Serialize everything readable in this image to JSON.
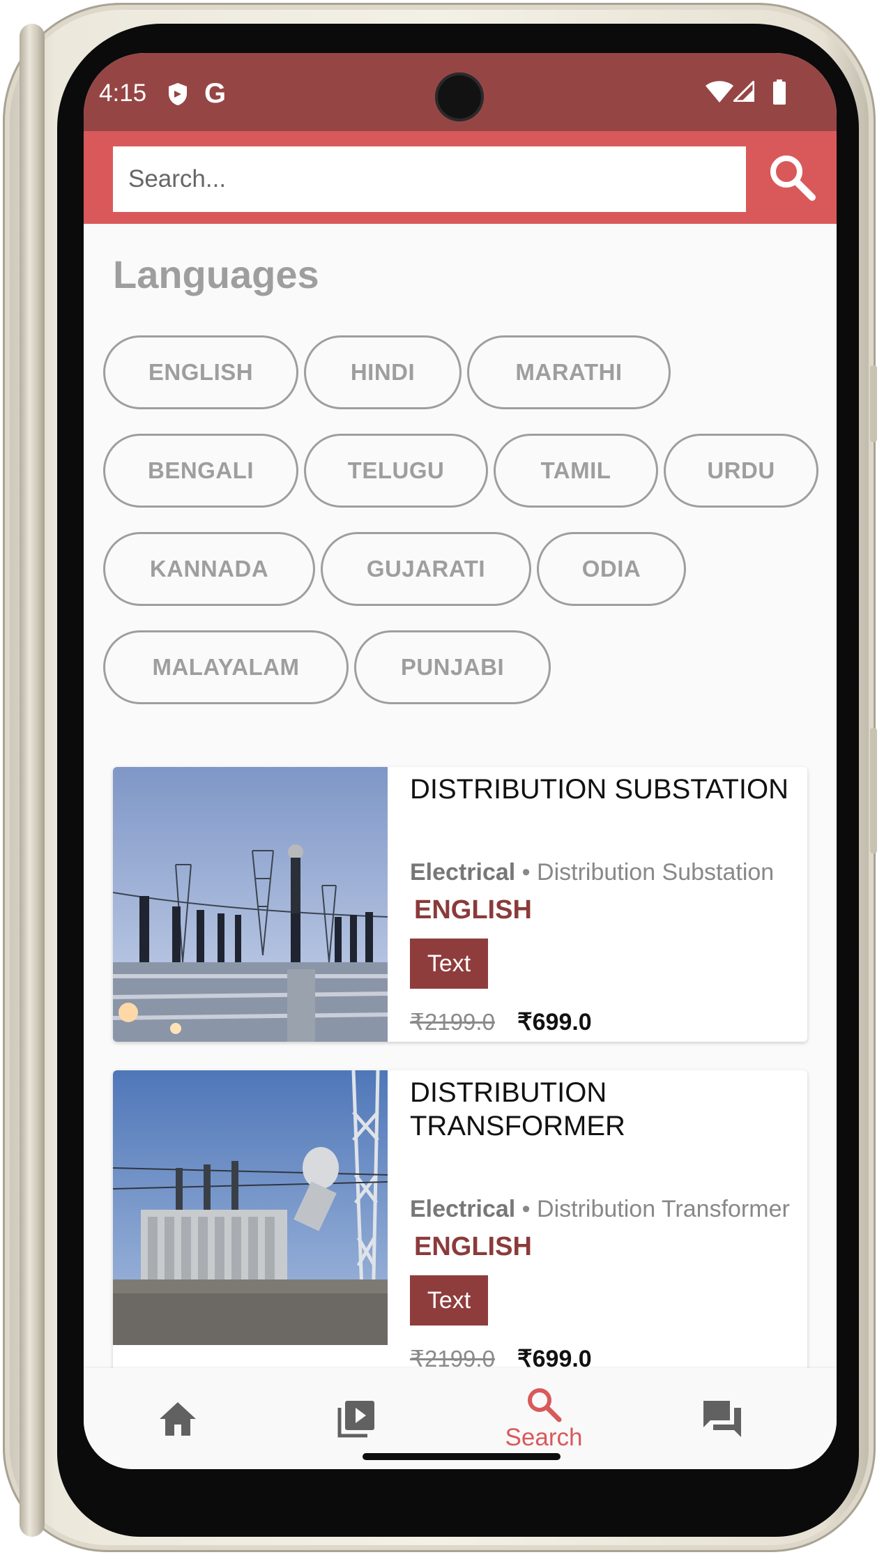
{
  "status_bar": {
    "time": "4:15",
    "g_label": "G"
  },
  "search": {
    "placeholder": "Search..."
  },
  "languages": {
    "title": "Languages",
    "items": [
      "ENGLISH",
      "HINDI",
      "MARATHI",
      "BENGALI",
      "TELUGU",
      "TAMIL",
      "URDU",
      "KANNADA",
      "GUJARATI",
      "ODIA",
      "MALAYALAM",
      "PUNJABI"
    ]
  },
  "courses": [
    {
      "title": "DISTRIBUTION SUBSTATION",
      "category": "Electrical",
      "separator": "•",
      "subcategory": "Distribution Substation",
      "language": "ENGLISH",
      "type": "Text",
      "old_price": "₹2199.0",
      "price": "₹699.0"
    },
    {
      "title": "DISTRIBUTION TRANSFORMER",
      "category": "Electrical",
      "separator": "•",
      "subcategory": "Distribution Transformer",
      "language": "ENGLISH",
      "type": "Text",
      "old_price": "₹2199.0",
      "price": "₹699.0"
    }
  ],
  "bottom_nav": {
    "items": [
      {
        "icon": "home-icon",
        "label": ""
      },
      {
        "icon": "video-library-icon",
        "label": ""
      },
      {
        "icon": "search-icon",
        "label": "Search"
      },
      {
        "icon": "forum-icon",
        "label": ""
      }
    ],
    "active_color": "#d9595a",
    "inactive_color": "#616161"
  },
  "colors": {
    "status_bar": "#964545",
    "header": "#d9595a",
    "badge": "#8f3c3c",
    "language_text": "#8b3a3a"
  }
}
